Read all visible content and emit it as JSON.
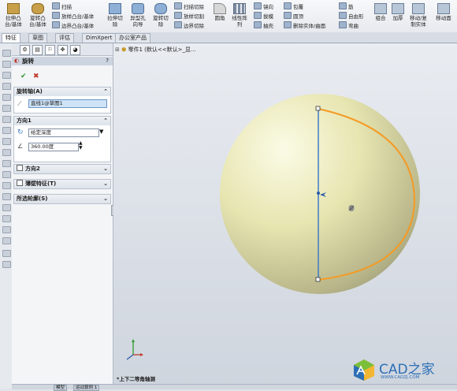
{
  "ribbon": {
    "big_buttons": [
      {
        "label": "拉伸凸\n台/基体",
        "icon": "extrude-boss-icon"
      },
      {
        "label": "旋转凸\n台/基体",
        "icon": "revolve-boss-icon"
      },
      {
        "label": "拉伸切\n除",
        "icon": "extrude-cut-icon"
      },
      {
        "label": "异型孔\n向导",
        "icon": "hole-wizard-icon"
      },
      {
        "label": "旋转切\n除",
        "icon": "revolve-cut-icon"
      },
      {
        "label": "圆角",
        "icon": "fillet-icon"
      },
      {
        "label": "线性阵\n列",
        "icon": "linear-pattern-icon"
      },
      {
        "label": "组合",
        "icon": "combine-icon"
      },
      {
        "label": "加厚",
        "icon": "thicken-icon"
      },
      {
        "label": "移动/复\n制实体",
        "icon": "move-copy-body-icon"
      },
      {
        "label": "移动面",
        "icon": "move-face-icon"
      }
    ],
    "small_buttons": [
      {
        "label": "扫描",
        "icon": "sweep-icon"
      },
      {
        "label": "放样凸台/基体",
        "icon": "loft-icon"
      },
      {
        "label": "边界凸台/基体",
        "icon": "boundary-boss-icon"
      },
      {
        "label": "扫描切除",
        "icon": "swept-cut-icon"
      },
      {
        "label": "放样切割",
        "icon": "lofted-cut-icon"
      },
      {
        "label": "边界切除",
        "icon": "boundary-cut-icon"
      },
      {
        "label": "筋",
        "icon": "rib-icon"
      },
      {
        "label": "拔模",
        "icon": "draft-icon"
      },
      {
        "label": "抽壳",
        "icon": "shell-icon"
      },
      {
        "label": "包覆",
        "icon": "wrap-icon"
      },
      {
        "label": "圆顶",
        "icon": "dome-icon"
      },
      {
        "label": "删除实体/曲面",
        "icon": "delete-body-icon"
      },
      {
        "label": "镜向",
        "icon": "mirror-icon"
      },
      {
        "label": "自由形",
        "icon": "freeform-icon"
      },
      {
        "label": "弯曲",
        "icon": "flex-icon"
      }
    ]
  },
  "tabs": [
    "特征",
    "草图",
    "评估",
    "DimXpert",
    "办公室产品"
  ],
  "property_manager": {
    "title": "旋转",
    "help": "?",
    "ok": "✔",
    "cancel": "✖",
    "axis_section": {
      "header": "旋转轴(A)",
      "value": "直线1@草图1"
    },
    "dir1_section": {
      "header": "方向1",
      "type_value": "给定深度",
      "angle_value": "360.00度"
    },
    "dir2_section": {
      "header": "方向2"
    },
    "thin_section": {
      "header": "薄壁特征(T)"
    },
    "contours_section": {
      "header": "所选轮廓(S)"
    }
  },
  "viewport": {
    "tree_label": "零件1 (默认<<默认>_显...",
    "view_label": "*上下二等角轴测"
  },
  "status_tabs": [
    "模型",
    "运动算例 1"
  ],
  "watermark": {
    "text": "CAD之家",
    "url": "WWW.CADZJ.COM"
  },
  "colors": {
    "sphere": "#e8e6b4",
    "profile": "#f59a24",
    "axis": "#3d7cc9",
    "brand": "#2c6fb6"
  }
}
